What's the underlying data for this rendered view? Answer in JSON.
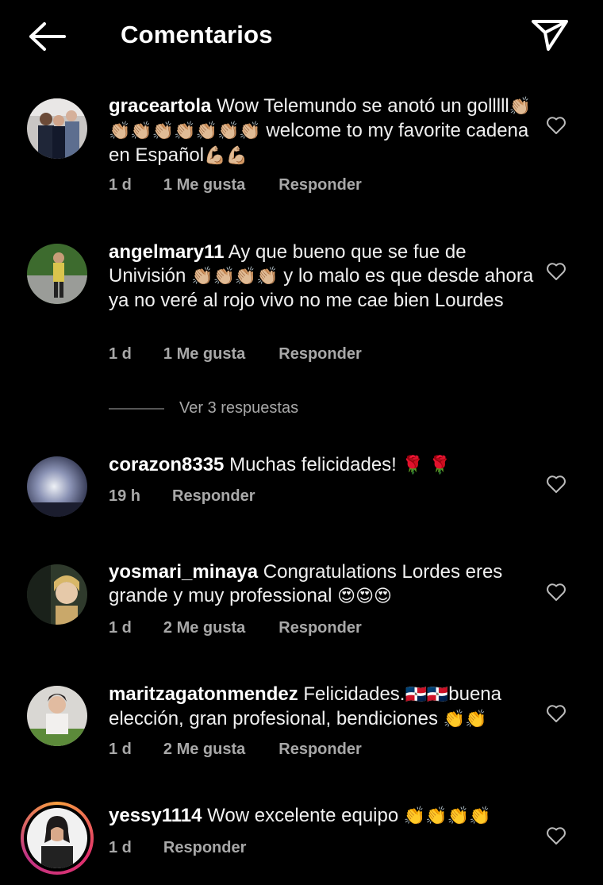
{
  "header": {
    "title": "Comentarios",
    "back_icon": "arrow-left-icon",
    "send_icon": "paper-plane-icon"
  },
  "comments": [
    {
      "username": "graceartola",
      "text": "Wow Telemundo se anotó un golllll",
      "emoji1": "👏🏼👏🏼👏🏼👏🏼👏🏼👏🏼👏🏼👏🏼",
      "text2": " welcome to my favorite cadena en Español",
      "emoji2": "💪🏼💪🏼",
      "time": "1 d",
      "likes": "1 Me gusta",
      "reply": "Responder"
    },
    {
      "username": "angelmary11",
      "text": "Ay que bueno que se fue de Univisión",
      "emoji1": "👏🏼👏🏼👏🏼👏🏼",
      "text2": " y lo malo es que desde ahora ya no veré al rojo vivo no me cae bien Lourdes",
      "time": "1 d",
      "likes": "1 Me gusta",
      "reply": "Responder"
    },
    {
      "username": "corazon8335",
      "text": "Muchas felicidades!",
      "emoji1": "🌹 🌹",
      "time": "19 h",
      "reply": "Responder"
    },
    {
      "username": "yosmari_minaya",
      "text": "Congratulations Lordes eres grande y muy professional",
      "emoji1": "😍😍😍",
      "time": "1 d",
      "likes": "2 Me gusta",
      "reply": "Responder"
    },
    {
      "username": "maritzagatonmendez",
      "text": "Felicidades.",
      "emoji1": "🇩🇴🇩🇴",
      "text2": "buena elección, gran profesional, bendiciones",
      "emoji2": "👏👏",
      "time": "1 d",
      "likes": "2 Me gusta",
      "reply": "Responder"
    },
    {
      "username": "yessy1114",
      "text": "Wow excelente equipo",
      "emoji1": "👏👏👏👏",
      "time": "1 d",
      "reply": "Responder"
    }
  ],
  "view_replies": "Ver 3 respuestas",
  "colors": {
    "background": "#000000",
    "primary_text": "#f5f5f5",
    "secondary_text": "#a8a8a8"
  }
}
